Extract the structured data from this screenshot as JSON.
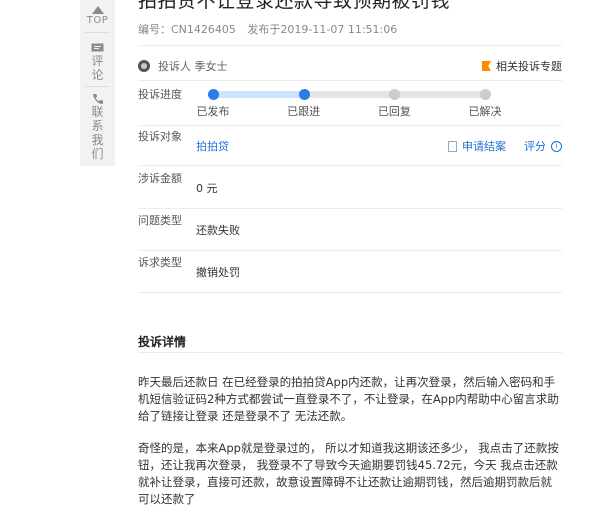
{
  "sidebar": {
    "top_label": "TOP",
    "comment_label": "评论",
    "contact_label": "联系我们"
  },
  "article": {
    "title": "拍拍贷不让登录还款导致预期被罚钱",
    "id_label": "编号：CN1426405",
    "published_label": "发布于2019-11-07 11:51:06",
    "complainant": "投诉人 季女士",
    "related_topic": "相关投诉专题"
  },
  "fields": {
    "progress_label": "投诉进度",
    "target_label": "投诉对象",
    "target_value": "拍拍贷",
    "amount_label": "涉诉金额",
    "amount_value": "0 元",
    "issue_label": "问题类型",
    "issue_value": "还款失败",
    "demand_label": "诉求类型",
    "demand_value": "撤销处罚"
  },
  "progress": {
    "stages": [
      "已发布",
      "已跟进",
      "已回复",
      "已解决"
    ],
    "completed": 2
  },
  "actions": {
    "join": "申请结案",
    "rate": "评分"
  },
  "details": {
    "title": "投诉详情",
    "p1": "昨天最后还款日 在已经登录的拍拍贷App内还款，让再次登录，然后输入密码和手机短信验证码2种方式都尝试一直登录不了，不让登录，在App内帮助中心留言求助 给了链接让登录 还是登录不了 无法还款。",
    "p2": "奇怪的是，本来App就是登录过的， 所以才知道我这期该还多少， 我点击了还款按钮，还让我再次登录， 我登录不了导致今天逾期要罚钱45.72元，今天 我点击还款就补让登录，直接可还款，故意设置障碍不让还款让逾期罚钱，然后逾期罚款后就可以还款了"
  }
}
